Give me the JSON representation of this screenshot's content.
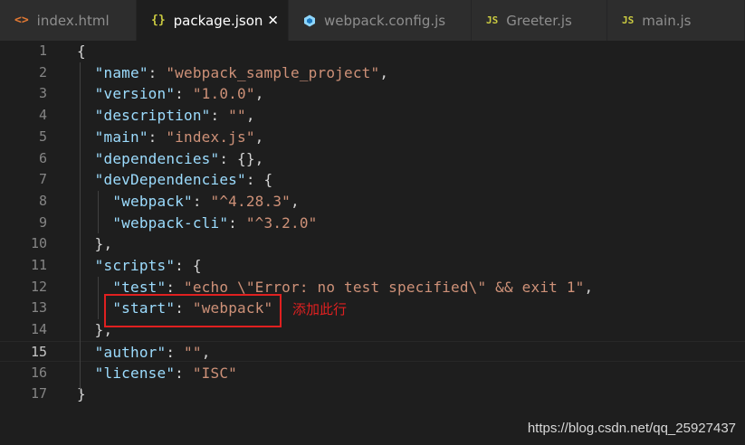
{
  "tabs": [
    {
      "label": "index.html",
      "icon": "html-file-icon",
      "icon_glyph": "<>",
      "active": false
    },
    {
      "label": "package.json",
      "icon": "json-file-icon",
      "icon_glyph": "{}",
      "active": true,
      "close": "✕"
    },
    {
      "label": "webpack.config.js",
      "icon": "webpack-file-icon",
      "icon_glyph": "",
      "active": false
    },
    {
      "label": "Greeter.js",
      "icon": "js-file-icon",
      "icon_glyph": "JS",
      "active": false
    },
    {
      "label": "main.js",
      "icon": "js-file-icon",
      "icon_glyph": "JS",
      "active": false
    }
  ],
  "editor": {
    "current_line": 15,
    "lines": [
      {
        "n": "1",
        "tokens": [
          [
            "p",
            "{"
          ]
        ]
      },
      {
        "n": "2",
        "tokens": [
          [
            "p",
            "  "
          ],
          [
            "k",
            "\"name\""
          ],
          [
            "p",
            ": "
          ],
          [
            "s",
            "\"webpack_sample_project\""
          ],
          [
            "p",
            ","
          ]
        ]
      },
      {
        "n": "3",
        "tokens": [
          [
            "p",
            "  "
          ],
          [
            "k",
            "\"version\""
          ],
          [
            "p",
            ": "
          ],
          [
            "s",
            "\"1.0.0\""
          ],
          [
            "p",
            ","
          ]
        ]
      },
      {
        "n": "4",
        "tokens": [
          [
            "p",
            "  "
          ],
          [
            "k",
            "\"description\""
          ],
          [
            "p",
            ": "
          ],
          [
            "s",
            "\"\""
          ],
          [
            "p",
            ","
          ]
        ]
      },
      {
        "n": "5",
        "tokens": [
          [
            "p",
            "  "
          ],
          [
            "k",
            "\"main\""
          ],
          [
            "p",
            ": "
          ],
          [
            "s",
            "\"index.js\""
          ],
          [
            "p",
            ","
          ]
        ]
      },
      {
        "n": "6",
        "tokens": [
          [
            "p",
            "  "
          ],
          [
            "k",
            "\"dependencies\""
          ],
          [
            "p",
            ": {},"
          ]
        ]
      },
      {
        "n": "7",
        "tokens": [
          [
            "p",
            "  "
          ],
          [
            "k",
            "\"devDependencies\""
          ],
          [
            "p",
            ": {"
          ]
        ]
      },
      {
        "n": "8",
        "tokens": [
          [
            "p",
            "    "
          ],
          [
            "k",
            "\"webpack\""
          ],
          [
            "p",
            ": "
          ],
          [
            "s",
            "\"^4.28.3\""
          ],
          [
            "p",
            ","
          ]
        ]
      },
      {
        "n": "9",
        "tokens": [
          [
            "p",
            "    "
          ],
          [
            "k",
            "\"webpack-cli\""
          ],
          [
            "p",
            ": "
          ],
          [
            "s",
            "\"^3.2.0\""
          ]
        ]
      },
      {
        "n": "10",
        "tokens": [
          [
            "p",
            "  },"
          ]
        ]
      },
      {
        "n": "11",
        "tokens": [
          [
            "p",
            "  "
          ],
          [
            "k",
            "\"scripts\""
          ],
          [
            "p",
            ": {"
          ]
        ]
      },
      {
        "n": "12",
        "tokens": [
          [
            "p",
            "    "
          ],
          [
            "k",
            "\"test\""
          ],
          [
            "p",
            ": "
          ],
          [
            "s",
            "\"echo \\\"Error: no test specified\\\" && exit 1\""
          ],
          [
            "p",
            ","
          ]
        ]
      },
      {
        "n": "13",
        "tokens": [
          [
            "p",
            "    "
          ],
          [
            "k",
            "\"start\""
          ],
          [
            "p",
            ": "
          ],
          [
            "s",
            "\"webpack\""
          ]
        ]
      },
      {
        "n": "14",
        "tokens": [
          [
            "p",
            "  },"
          ]
        ]
      },
      {
        "n": "15",
        "tokens": [
          [
            "p",
            "  "
          ],
          [
            "k",
            "\"author\""
          ],
          [
            "p",
            ": "
          ],
          [
            "s",
            "\"\""
          ],
          [
            "p",
            ","
          ]
        ]
      },
      {
        "n": "16",
        "tokens": [
          [
            "p",
            "  "
          ],
          [
            "k",
            "\"license\""
          ],
          [
            "p",
            ": "
          ],
          [
            "s",
            "\"ISC\""
          ]
        ]
      },
      {
        "n": "17",
        "tokens": [
          [
            "p",
            "}"
          ]
        ]
      }
    ]
  },
  "annotation": {
    "text": "添加此行",
    "color": "#e02020"
  },
  "watermark": "https://blog.csdn.net/qq_25927437",
  "colors": {
    "background": "#1e1e1e",
    "tabbar": "#252526",
    "tab_inactive": "#2d2d2d",
    "key": "#9cdcfe",
    "string": "#ce9178",
    "punctuation": "#d4d4d4",
    "line_number": "#858585",
    "highlight": "#e02020"
  }
}
